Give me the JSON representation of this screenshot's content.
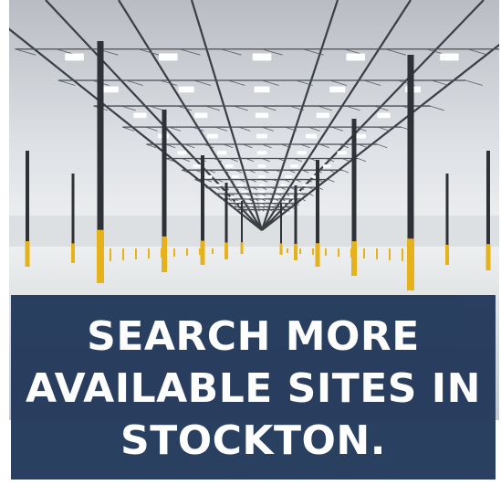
{
  "image": {
    "subject": "warehouse-interior-photo",
    "colors": {
      "banner": "#243a5c",
      "text": "#ffffff",
      "columns": "#2e3136",
      "bollards": "#e5b21b",
      "floor": "#d9dbde",
      "ceiling": "#c9ccd1"
    }
  },
  "banner": {
    "lines": [
      "SEARCH MORE",
      "AVAILABLE SITES IN",
      "STOCKTON."
    ]
  }
}
